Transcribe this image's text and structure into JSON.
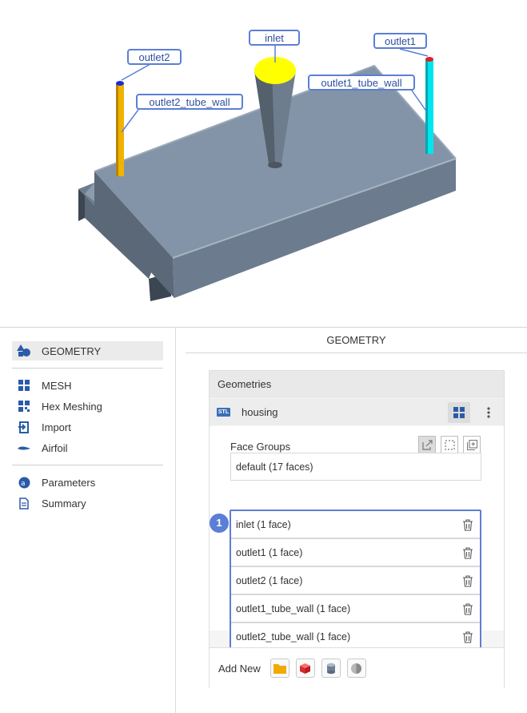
{
  "viewport": {
    "labels": {
      "inlet": "inlet",
      "outlet1": "outlet1",
      "outlet2": "outlet2",
      "outlet1_tube_wall": "outlet1_tube_wall",
      "outlet2_tube_wall": "outlet2_tube_wall"
    },
    "colors": {
      "inlet": "#ffff00",
      "outlet1_tube": "#00e5ee",
      "outlet2_tube": "#f0b400",
      "body": "#7c8c9e"
    }
  },
  "sidebar": {
    "active": {
      "label": "GEOMETRY",
      "icon": "shapes-icon"
    },
    "items": [
      {
        "label": "MESH",
        "icon": "grid-icon"
      },
      {
        "label": "Hex Meshing",
        "icon": "hex-grid-icon"
      },
      {
        "label": "Import",
        "icon": "import-icon"
      },
      {
        "label": "Airfoil",
        "icon": "airfoil-icon"
      }
    ],
    "bottom_items": [
      {
        "label": "Parameters",
        "icon": "parameters-icon"
      },
      {
        "label": "Summary",
        "icon": "document-icon"
      }
    ]
  },
  "main": {
    "title": "GEOMETRY",
    "geometries": {
      "heading": "Geometries",
      "item": {
        "badge": "STL",
        "name": "housing"
      },
      "face_groups_label": "Face Groups",
      "default_row": "default  (17 faces)",
      "rows": [
        "inlet  (1 face)",
        "outlet1  (1 face)",
        "outlet2  (1 face)",
        "outlet1_tube_wall  (1 face)",
        "outlet2_tube_wall  (1 face)"
      ],
      "step_badge": "1",
      "add_new_label": "Add New"
    },
    "accent": "#5b7fd6"
  }
}
